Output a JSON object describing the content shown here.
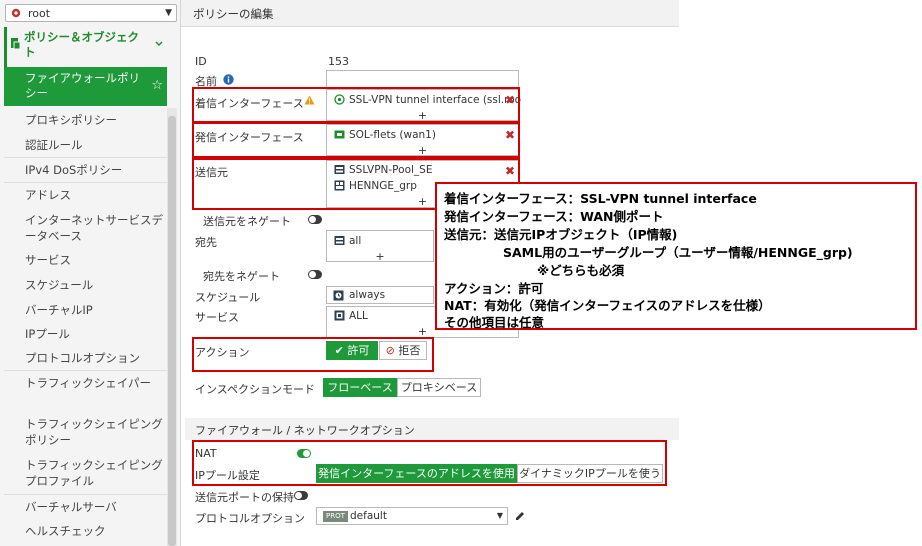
{
  "sidebar": {
    "vdom": "root",
    "section_title": "ポリシー＆オブジェクト",
    "active_item": "ファイアウォールポリシー",
    "items": [
      "プロキシポリシー",
      "認証ルール",
      "IPv4 DoSポリシー",
      "アドレス",
      "インターネットサービスデータベース",
      "サービス",
      "スケジュール",
      "バーチャルIP",
      "IPプール",
      "プロトコルオプション",
      "トラフィックシェイパー",
      "トラフィックシェイピングポリシー",
      "トラフィックシェイピングプロファイル",
      "バーチャルサーバ",
      "ヘルスチェック"
    ]
  },
  "page": {
    "title": "ポリシーの編集"
  },
  "form": {
    "id_label": "ID",
    "id_value": "153",
    "name_label": "名前",
    "name_value": "",
    "incoming_label": "着信インターフェース",
    "incoming_value": "SSL-VPN tunnel interface (ssl.roo",
    "outgoing_label": "発信インターフェース",
    "outgoing_value": "SOL-flets (wan1)",
    "source_label": "送信元",
    "source_values": [
      "SSLVPN-Pool_SE",
      "HENNGE_grp"
    ],
    "negate_source_label": "送信元をネゲート",
    "dest_label": "宛先",
    "dest_value": "all",
    "negate_dest_label": "宛先をネゲート",
    "schedule_label": "スケジュール",
    "schedule_value": "always",
    "service_label": "サービス",
    "service_value": "ALL",
    "action_label": "アクション",
    "action_accept": "許可",
    "action_deny": "拒否",
    "inspection_label": "インスペクションモード",
    "inspection_flow": "フローベース",
    "inspection_proxy": "プロキシベース",
    "plus": "+"
  },
  "fw_section": {
    "title": "ファイアウォール / ネットワークオプション",
    "nat_label": "NAT",
    "ippool_label": "IPプール設定",
    "ippool_out": "発信インターフェースのアドレスを使用",
    "ippool_dyn": "ダイナミックIPプールを使う",
    "preserve_port_label": "送信元ポートの保持",
    "protocol_label": "プロトコルオプション",
    "protocol_badge": "PROT",
    "protocol_value": "default"
  },
  "annotation": {
    "lines": [
      "着信インターフェース：SSL-VPN tunnel interface",
      "発信インターフェース：WAN側ポート",
      "送信元：送信元IPオブジェクト（IP情報)",
      "SAML用のユーザーグループ（ユーザー情報/HENNGE_grp)",
      "※どちらも必須",
      "アクション：許可",
      "NAT：有効化（発信インターフェイスのアドレスを仕様）",
      "その他項目は任意"
    ]
  },
  "colors": {
    "accent": "#1f9a3a",
    "highlight": "#d40000"
  }
}
